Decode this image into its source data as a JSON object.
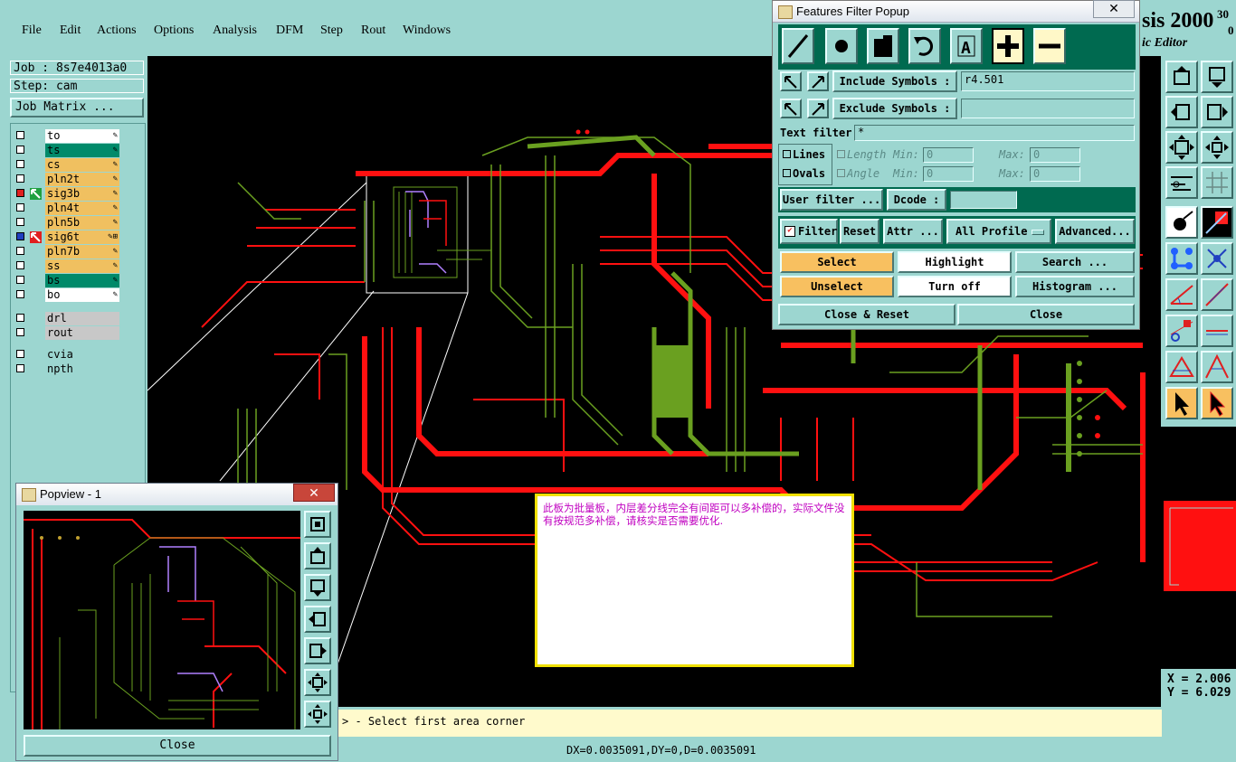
{
  "menu": {
    "items": [
      "File",
      "Edit",
      "Actions",
      "Options",
      "Analysis",
      "DFM",
      "Step",
      "Rout",
      "Windows"
    ]
  },
  "app_title": {
    "text": "sis 2000",
    "superscript": "30",
    "sub_superscript": "0",
    "subtitle": "ic Editor"
  },
  "job": {
    "label": "Job : 8s7e4013a0",
    "step": "Step: cam",
    "matrix_button": "Job Matrix ..."
  },
  "layers": [
    {
      "name": "to",
      "color": "#ffffff",
      "pen": "✎",
      "marker": ""
    },
    {
      "name": "ts",
      "color": "#008a6a",
      "pen": "✎",
      "marker": ""
    },
    {
      "name": "cs",
      "color": "#f0c060",
      "pen": "✎",
      "marker": ""
    },
    {
      "name": "pln2t",
      "color": "#f0c060",
      "pen": "✎",
      "marker": ""
    },
    {
      "name": "sig3b",
      "color": "#f0c060",
      "pen": "✎",
      "marker": "green"
    },
    {
      "name": "pln4t",
      "color": "#f0c060",
      "pen": "✎",
      "marker": ""
    },
    {
      "name": "pln5b",
      "color": "#f0c060",
      "pen": "✎",
      "marker": ""
    },
    {
      "name": "sig6t",
      "color": "#f0c060",
      "pen": "✎⊞",
      "marker": "red"
    },
    {
      "name": "pln7b",
      "color": "#f0c060",
      "pen": "✎",
      "marker": ""
    },
    {
      "name": "ss",
      "color": "#f0c060",
      "pen": "✎",
      "marker": ""
    },
    {
      "name": "bs",
      "color": "#008a6a",
      "pen": "✎",
      "marker": ""
    },
    {
      "name": "bo",
      "color": "#ffffff",
      "pen": "✎",
      "marker": ""
    }
  ],
  "drill_layers": [
    {
      "name": "drl",
      "color": "#c8c8c8"
    },
    {
      "name": "rout",
      "color": "#c8c8c8"
    }
  ],
  "other_layers": [
    {
      "name": "cvia",
      "color": "#9cd6d0"
    },
    {
      "name": "npth",
      "color": "#9cd6d0"
    }
  ],
  "filter_popup": {
    "title": "Features Filter Popup",
    "close_x": "✕",
    "include_symbols_label": "Include Symbols :",
    "include_symbols_value": "r4.501",
    "exclude_symbols_label": "Exclude Symbols :",
    "exclude_symbols_value": "",
    "text_filter_label": "Text filter",
    "text_filter_value": "*",
    "lines_label": "Lines",
    "ovals_label": "Ovals",
    "length_label": "Length",
    "angle_label": "Angle",
    "min_label": "Min:",
    "max_label": "Max:",
    "length_min": "0",
    "length_max": "0",
    "angle_min": "0",
    "angle_max": "0",
    "user_filter_button": "User filter ...",
    "dcode_label": "Dcode :",
    "dcode_value": "",
    "filter_label": "Filter",
    "reset_button": "Reset",
    "attr_button": "Attr ...",
    "profile_option": "All Profile",
    "advanced_button": "Advanced...",
    "select_button": "Select",
    "highlight_button": "Highlight",
    "search_button": "Search ...",
    "unselect_button": "Unselect",
    "turnoff_button": "Turn off",
    "histogram_button": "Histogram ...",
    "close_reset_button": "Close & Reset",
    "close_button": "Close"
  },
  "popview": {
    "title": "Popview - 1",
    "close_x": "✕",
    "close_button": "Close"
  },
  "note": {
    "text": "此板为批量板，内层差分线完全有间距可以多补偿的，实际文件没有按规范多补偿，请核实是否需要优化."
  },
  "prompt": {
    "text": "> - Select first area corner"
  },
  "status": {
    "text": "DX=0.0035091,DY=0,D=0.0035091"
  },
  "coords": {
    "x": "X = 2.006",
    "y": "Y = 6.029"
  },
  "colors": {
    "panel": "#9cd6d0",
    "canvas": "#000000",
    "trace_red": "#ff1010",
    "trace_green": "#6aa020",
    "select_orange": "#f8c060"
  }
}
